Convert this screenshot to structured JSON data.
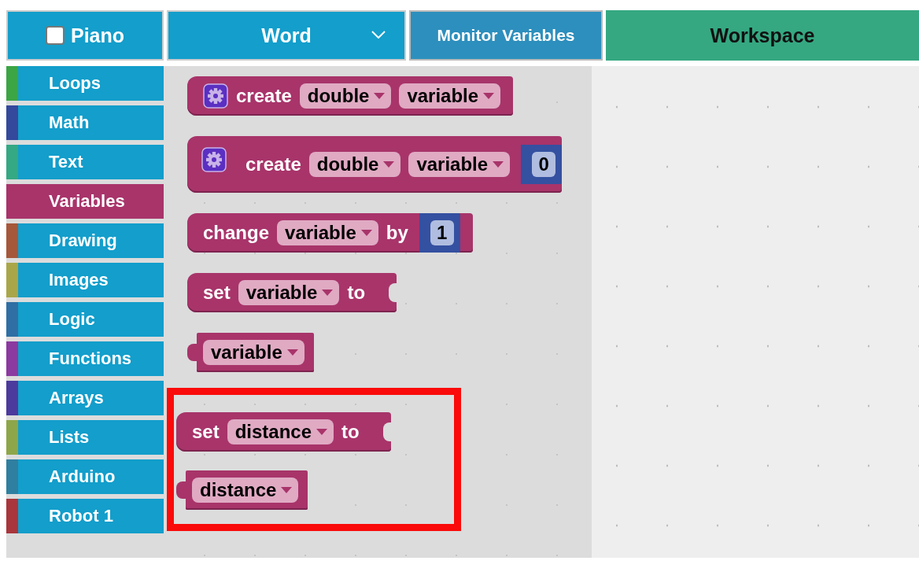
{
  "header": {
    "sketch": {
      "label": "Piano",
      "checked": false
    },
    "language": {
      "label": "Word"
    },
    "monitor_button": "Monitor Variables",
    "workspace_tab": "Workspace"
  },
  "categories": [
    {
      "label": "Loops",
      "color": "#3ca544",
      "selected": false
    },
    {
      "label": "Math",
      "color": "#34499c",
      "selected": false
    },
    {
      "label": "Text",
      "color": "#35a884",
      "selected": false
    },
    {
      "label": "Variables",
      "color": "#a8346a",
      "selected": true
    },
    {
      "label": "Drawing",
      "color": "#a6583a",
      "selected": false
    },
    {
      "label": "Images",
      "color": "#a9a64a",
      "selected": false
    },
    {
      "label": "Logic",
      "color": "#2f6fa4",
      "selected": false
    },
    {
      "label": "Functions",
      "color": "#8b3a9f",
      "selected": false
    },
    {
      "label": "Arrays",
      "color": "#4c3a9c",
      "selected": false
    },
    {
      "label": "Lists",
      "color": "#8ea64a",
      "selected": false
    },
    {
      "label": "Arduino",
      "color": "#2f7fa0",
      "selected": false
    },
    {
      "label": "Robot 1",
      "color": "#a8363c",
      "selected": false
    }
  ],
  "block_groups": [
    {
      "highlighted": false,
      "blocks": [
        {
          "kind": "statement",
          "gear": true,
          "parts": [
            {
              "kind": "text",
              "text": "create"
            },
            {
              "kind": "dropdown",
              "text": "double"
            },
            {
              "kind": "dropdown",
              "text": "variable"
            }
          ]
        },
        {
          "kind": "statement",
          "gear": true,
          "parts": [
            {
              "kind": "text",
              "text": "create"
            },
            {
              "kind": "dropdown",
              "text": "double"
            },
            {
              "kind": "dropdown",
              "text": "variable"
            },
            {
              "kind": "number",
              "text": "0"
            }
          ]
        },
        {
          "kind": "statement",
          "gear": false,
          "parts": [
            {
              "kind": "text",
              "text": "change"
            },
            {
              "kind": "dropdown",
              "text": "variable"
            },
            {
              "kind": "text",
              "text": "by"
            },
            {
              "kind": "number",
              "text": "1"
            }
          ]
        },
        {
          "kind": "statement",
          "gear": false,
          "parts": [
            {
              "kind": "text",
              "text": "set"
            },
            {
              "kind": "dropdown",
              "text": "variable"
            },
            {
              "kind": "text",
              "text": "to"
            },
            {
              "kind": "socket"
            }
          ]
        },
        {
          "kind": "value",
          "gear": false,
          "parts": [
            {
              "kind": "dropdown",
              "text": "variable"
            }
          ]
        }
      ]
    },
    {
      "highlighted": true,
      "blocks": [
        {
          "kind": "statement",
          "gear": false,
          "parts": [
            {
              "kind": "text",
              "text": "set"
            },
            {
              "kind": "dropdown",
              "text": "distance"
            },
            {
              "kind": "text",
              "text": "to"
            },
            {
              "kind": "socket"
            }
          ]
        },
        {
          "kind": "value",
          "gear": false,
          "parts": [
            {
              "kind": "dropdown",
              "text": "distance"
            }
          ]
        }
      ]
    }
  ]
}
